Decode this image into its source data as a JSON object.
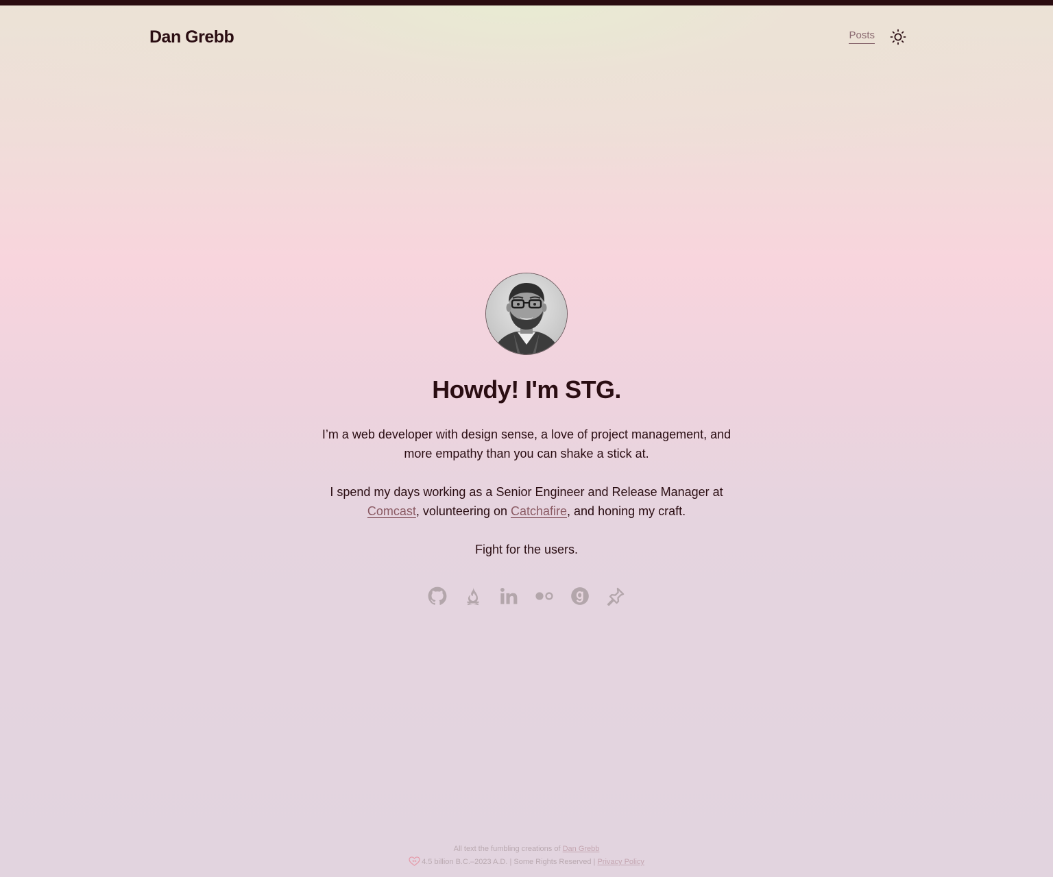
{
  "header": {
    "site_title": "Dan Grebb",
    "nav": [
      {
        "label": "Posts"
      }
    ],
    "theme_toggle_icon": "sun-icon"
  },
  "hero": {
    "avatar_alt": "portrait-photo",
    "headline": "Howdy! I'm STG.",
    "paragraph1": "I’m a web developer with design sense, a love of project management, and more empathy than you can shake a stick at.",
    "paragraph2": {
      "before": "I spend my days working as a Senior Engineer and Release Manager at ",
      "link1": "Comcast",
      "between": ", volunteering on ",
      "link2": "Catchafire",
      "after": ", and honing my craft."
    },
    "paragraph3": "Fight for the users."
  },
  "social_links": [
    {
      "icon": "github-icon"
    },
    {
      "icon": "campfire-icon"
    },
    {
      "icon": "linkedin-icon"
    },
    {
      "icon": "flickr-icon"
    },
    {
      "icon": "goodreads-icon"
    },
    {
      "icon": "pin-icon"
    }
  ],
  "footer": {
    "line1_text": "All text the fumbling creations of ",
    "line1_link": "Dan Grebb",
    "line2_text": "4.5 billion B.C.–2023 A.D. | Some Rights Reserved | ",
    "line2_link": "Privacy Policy"
  },
  "colors": {
    "text": "#2a0d12",
    "link": "#8a5a63",
    "icon": "#b3a6ab",
    "top_bar": "#2a0c10"
  }
}
